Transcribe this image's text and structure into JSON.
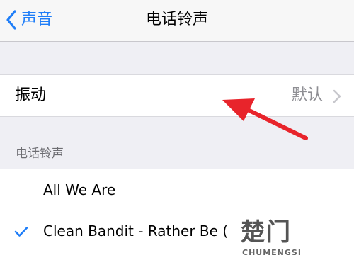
{
  "navbar": {
    "back_label": "声音",
    "title": "电话铃声",
    "accent_color": "#1f7ef8"
  },
  "vibration": {
    "label": "振动",
    "value": "默认"
  },
  "ringtones": {
    "section_header": "电话铃声",
    "items": [
      {
        "name": "All We Are",
        "selected": false
      },
      {
        "name": "Clean Bandit - Rather Be (",
        "selected": true
      }
    ]
  },
  "annotation": {
    "color": "#e8242b",
    "icon": "red-arrow"
  },
  "watermark": {
    "cn": "楚门",
    "en": "CHUMENGSI"
  }
}
